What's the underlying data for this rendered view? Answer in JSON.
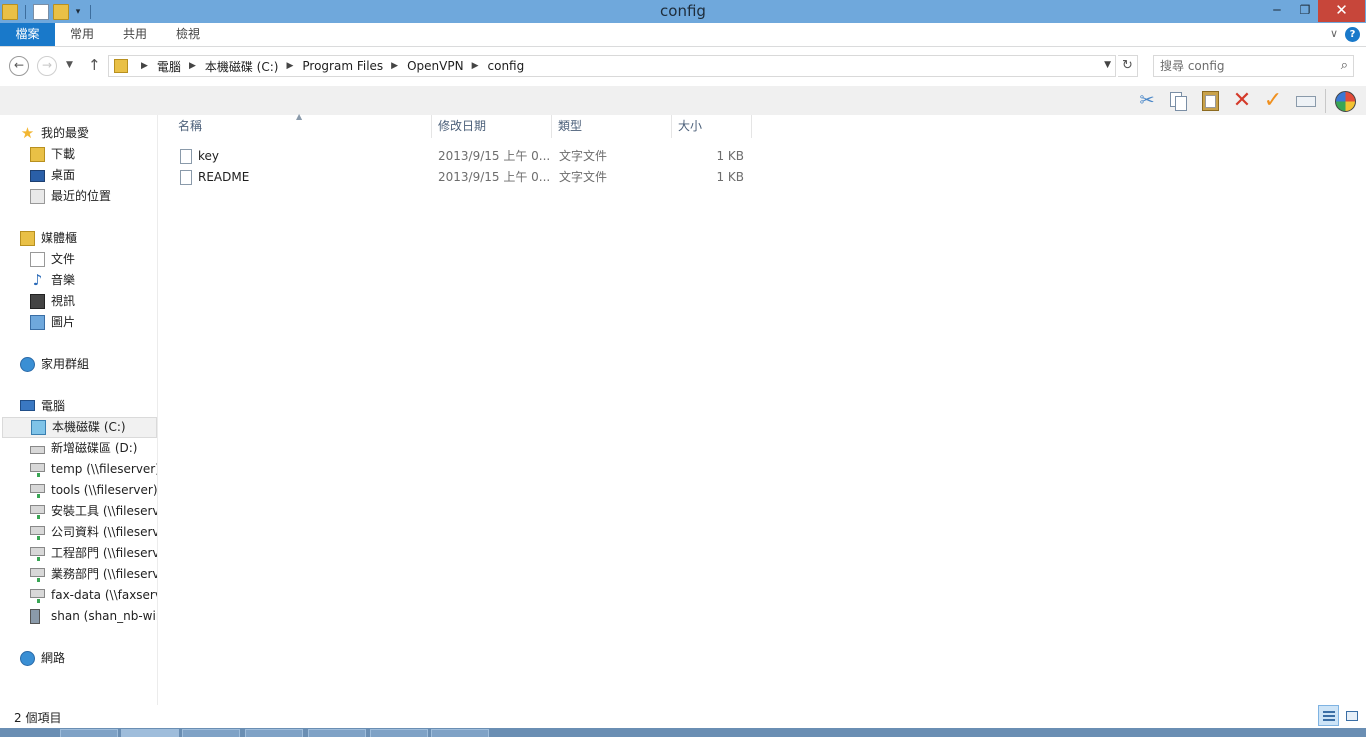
{
  "window": {
    "title": "config"
  },
  "ribbon": {
    "tabs": [
      "檔案",
      "常用",
      "共用",
      "檢視"
    ]
  },
  "address": {
    "crumbs": [
      "電腦",
      "本機磁碟 (C:)",
      "Program Files",
      "OpenVPN",
      "config"
    ]
  },
  "search": {
    "placeholder": "搜尋 config"
  },
  "nav": {
    "favorites": "我的最愛",
    "downloads": "下載",
    "desktop": "桌面",
    "recent": "最近的位置",
    "libraries": "媒體櫃",
    "documents": "文件",
    "music": "音樂",
    "videos": "視訊",
    "pictures": "圖片",
    "homegroup": "家用群組",
    "computer": "電腦",
    "drives": [
      "本機磁碟 (C:)",
      "新增磁碟區 (D:)",
      "temp (\\\\fileserver) (",
      "tools (\\\\fileserver) (",
      "安裝工具 (\\\\fileserver",
      "公司資料 (\\\\fileserver",
      "工程部門 (\\\\fileserver",
      "業務部門 (\\\\fileserver",
      "fax-data (\\\\faxserver",
      "shan (shan_nb-win8"
    ],
    "network": "網路"
  },
  "columns": {
    "name": "名稱",
    "date": "修改日期",
    "type": "類型",
    "size": "大小"
  },
  "files": [
    {
      "name": "key",
      "date": "2013/9/15 上午 0...",
      "type": "文字文件",
      "size": "1 KB"
    },
    {
      "name": "README",
      "date": "2013/9/15 上午 0...",
      "type": "文字文件",
      "size": "1 KB"
    }
  ],
  "status": {
    "count": "2 個項目"
  },
  "colors": {
    "title_bar": "#6fa8dc",
    "file_tab": "#1979ca",
    "close_button": "#c7463a",
    "selection": "#f1f1f1"
  }
}
